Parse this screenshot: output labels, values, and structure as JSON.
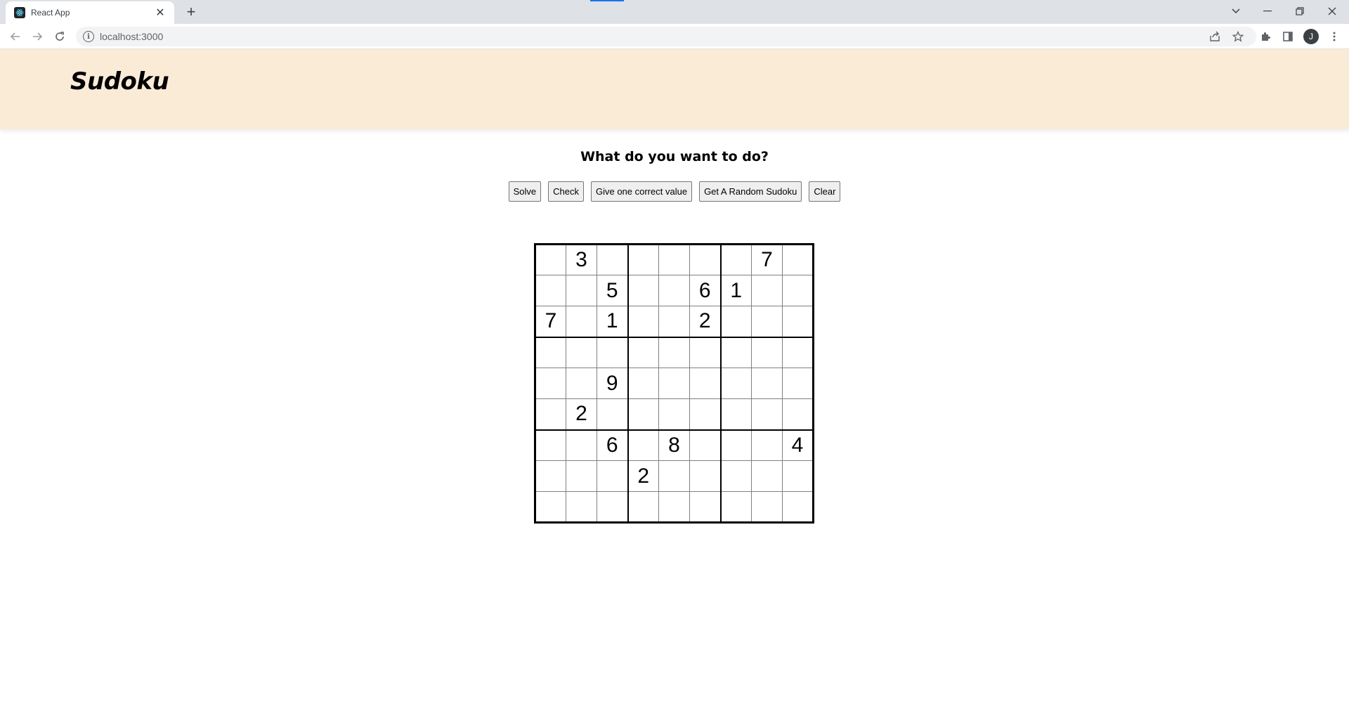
{
  "browser": {
    "tab_title": "React App",
    "url": "localhost:3000",
    "profile_initial": "J"
  },
  "app": {
    "title": "Sudoku",
    "prompt": "What do you want to do?",
    "buttons": {
      "solve": "Solve",
      "check": "Check",
      "hint": "Give one correct value",
      "random": "Get A Random Sudoku",
      "clear": "Clear"
    },
    "board": [
      [
        "",
        "3",
        "",
        "",
        "",
        "",
        "",
        "7",
        ""
      ],
      [
        "",
        "",
        "5",
        "",
        "",
        "6",
        "1",
        "",
        ""
      ],
      [
        "7",
        "",
        "1",
        "",
        "",
        "2",
        "",
        "",
        ""
      ],
      [
        "",
        "",
        "",
        "",
        "",
        "",
        "",
        "",
        ""
      ],
      [
        "",
        "",
        "9",
        "",
        "",
        "",
        "",
        "",
        ""
      ],
      [
        "",
        "2",
        "",
        "",
        "",
        "",
        "",
        "",
        ""
      ],
      [
        "",
        "",
        "6",
        "",
        "8",
        "",
        "",
        "",
        "4"
      ],
      [
        "",
        "",
        "",
        "2",
        "",
        "",
        "",
        "",
        ""
      ],
      [
        "",
        "",
        "",
        "",
        "",
        "",
        "",
        "",
        ""
      ]
    ]
  },
  "colors": {
    "header_bg": "#faebd7",
    "tab_strip": "#dee1e6"
  }
}
